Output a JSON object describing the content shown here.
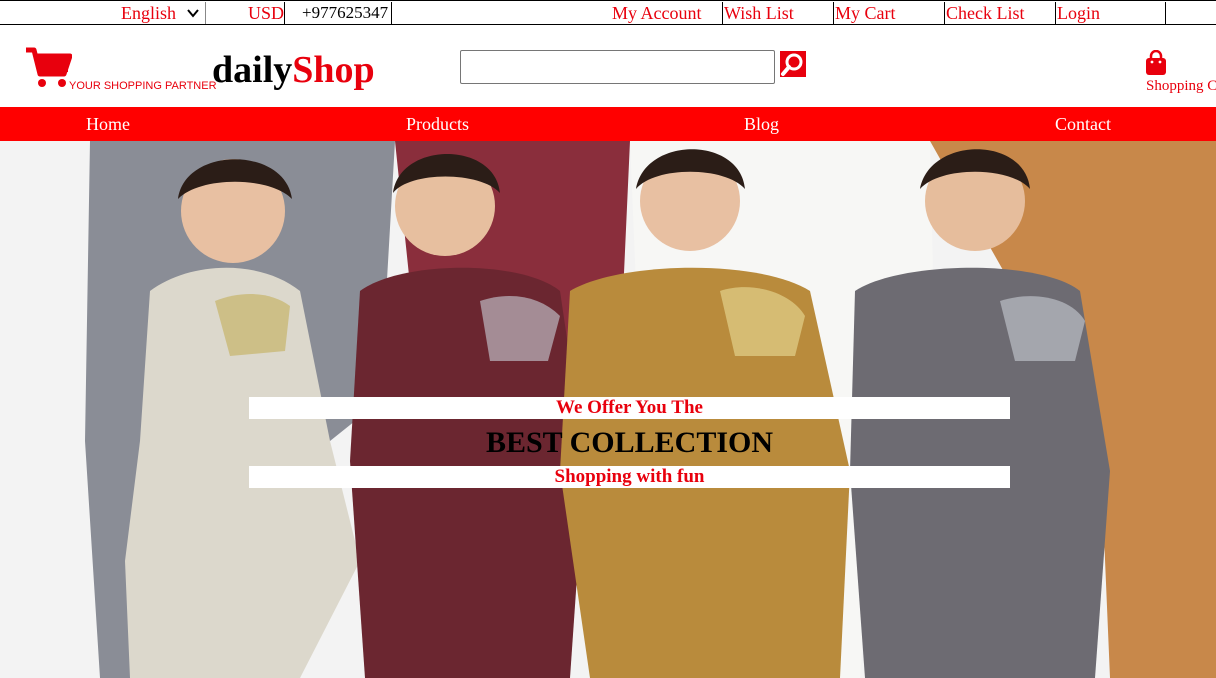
{
  "topbar": {
    "language": "English",
    "currency": "USD",
    "phone": "+977625347",
    "links": {
      "account": "My Account",
      "wishlist": "Wish List",
      "cart": "My Cart",
      "checklist": "Check List",
      "login": "Login"
    }
  },
  "header": {
    "tagline": "YOUR SHOPPING PARTNER",
    "brand_part1": "daily",
    "brand_part2": "Shop",
    "search_placeholder": "",
    "cart_label": "Shopping Cart"
  },
  "nav": {
    "home": "Home",
    "products": "Products",
    "blog": "Blog",
    "contact": "Contact"
  },
  "hero": {
    "line1": "We Offer You The",
    "headline": "BEST COLLECTION",
    "line2": "Shopping with fun"
  },
  "icons": {
    "logo": "shopping-cart-icon",
    "search": "search-icon",
    "bag": "shopping-bag-icon",
    "dropdown": "chevron-down-icon"
  },
  "colors": {
    "accent": "#e8000d",
    "nav_bg": "#ff0000"
  }
}
